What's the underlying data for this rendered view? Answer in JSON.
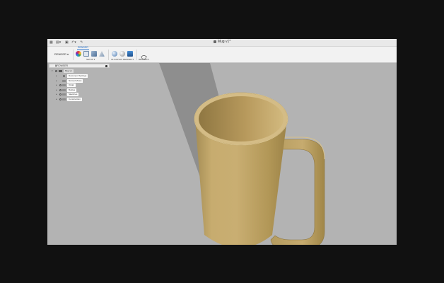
{
  "window": {
    "title": "Mug v1*"
  },
  "quick_access": {
    "grid_icon": "grid-icon",
    "file_icon": "file-icon",
    "save_icon": "save-icon",
    "undo_icon": "undo-icon",
    "redo_icon": "redo-icon"
  },
  "toolbar": {
    "workspace": "RENDER ▾",
    "active_tab": "RENDER",
    "groups": [
      {
        "label": "SETUP ▾"
      },
      {
        "label": "IN-CANVAS RENDER ▾"
      },
      {
        "label": "RENDER ▾"
      }
    ]
  },
  "browser": {
    "title": "BROWSER",
    "root": "Mug v1",
    "items": [
      {
        "label": "Document Settings"
      },
      {
        "label": "Named Views"
      },
      {
        "label": "Origin"
      },
      {
        "label": "Bodies"
      },
      {
        "label": "Sketches"
      },
      {
        "label": "Construction"
      }
    ]
  },
  "colors": {
    "background": "#111111",
    "viewport": "#b3b3b3",
    "mug": "#c9ae72",
    "accent": "#1b6ac9"
  }
}
